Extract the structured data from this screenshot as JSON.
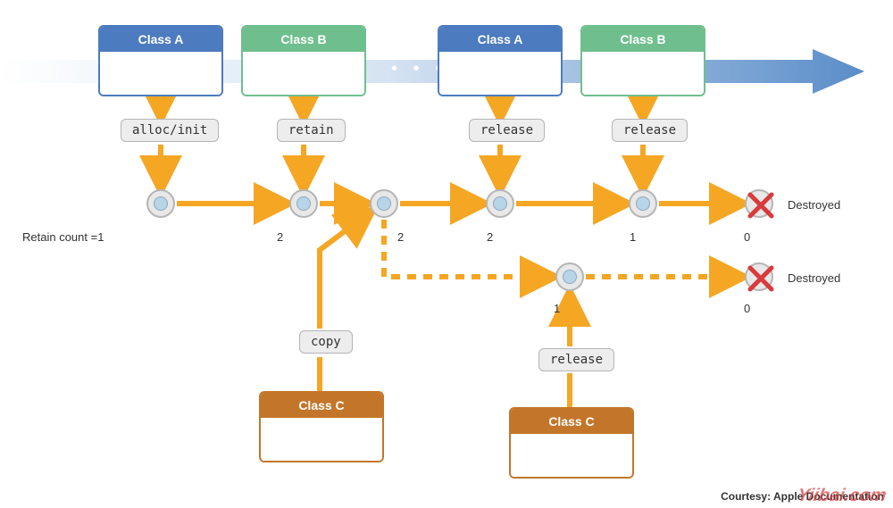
{
  "classes": {
    "a1": "Class A",
    "b1": "Class B",
    "a2": "Class A",
    "b2": "Class B",
    "c1": "Class C",
    "c2": "Class C"
  },
  "operations": {
    "alloc_init": "alloc/init",
    "retain": "retain",
    "release1": "release",
    "release2": "release",
    "copy": "copy",
    "release3": "release"
  },
  "counts": {
    "retain_label": "Retain count =1",
    "c2": "2",
    "c3": "2",
    "c4": "2",
    "c5": "1",
    "c6": "0",
    "c7": "1",
    "c8": "0"
  },
  "labels": {
    "destroyed1": "Destroyed",
    "destroyed2": "Destroyed"
  },
  "footer": {
    "courtesy": "Courtesy: Apple Documentation",
    "watermark": "Yiibai.com"
  },
  "colors": {
    "orange_arrow": "#f5a623",
    "blue": "#4c7cbf",
    "green": "#6fbf8e",
    "brown": "#c3762a",
    "red_x": "#d93b3b"
  }
}
